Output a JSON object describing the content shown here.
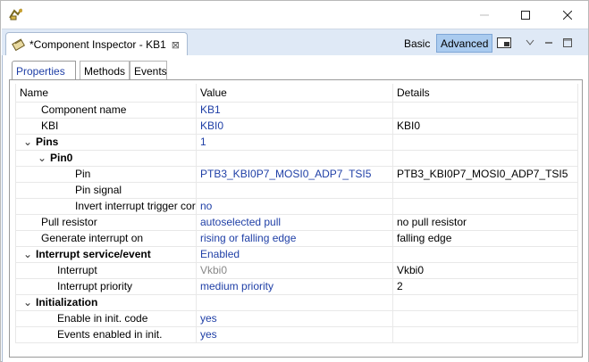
{
  "view": {
    "title": "*Component Inspector - KB1",
    "basic_label": "Basic",
    "advanced_label": "Advanced"
  },
  "subtabs": [
    "Properties",
    "Methods",
    "Events"
  ],
  "columns": {
    "name": "Name",
    "value": "Value",
    "details": "Details"
  },
  "rows": [
    {
      "name": "Component name",
      "value": "KB1",
      "details": ""
    },
    {
      "name": "KBI",
      "value": "KBI0",
      "details": "KBI0"
    },
    {
      "name": "Pins",
      "value": "1",
      "details": ""
    },
    {
      "name": "Pin0",
      "value": "",
      "details": ""
    },
    {
      "name": "Pin",
      "value": "PTB3_KBI0P7_MOSI0_ADP7_TSI5",
      "details": "PTB3_KBI0P7_MOSI0_ADP7_TSI5"
    },
    {
      "name": "Pin signal",
      "value": "",
      "details": ""
    },
    {
      "name": "Invert interrupt trigger cor",
      "value": "no",
      "details": ""
    },
    {
      "name": "Pull resistor",
      "value": "autoselected pull",
      "details": "no pull resistor"
    },
    {
      "name": "Generate interrupt on",
      "value": "rising or falling edge",
      "details": "falling edge"
    },
    {
      "name": "Interrupt service/event",
      "value": "Enabled",
      "details": ""
    },
    {
      "name": "Interrupt",
      "value": "Vkbi0",
      "details": "Vkbi0"
    },
    {
      "name": "Interrupt priority",
      "value": "medium priority",
      "details": "2"
    },
    {
      "name": "Initialization",
      "value": "",
      "details": ""
    },
    {
      "name": "Enable in init. code",
      "value": "yes",
      "details": ""
    },
    {
      "name": "Events enabled in init.",
      "value": "yes",
      "details": ""
    }
  ]
}
